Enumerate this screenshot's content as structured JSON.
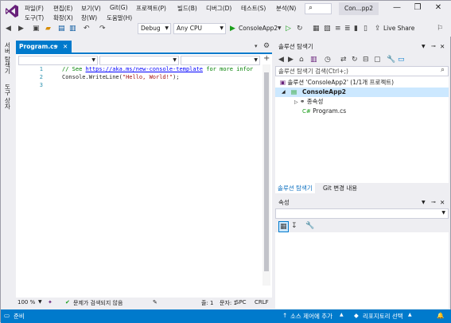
{
  "menu": {
    "items_row1": [
      "파일(F)",
      "편집(E)",
      "보기(V)",
      "Git(G)",
      "프로젝트(P)",
      "빌드(B)",
      "디버그(D)",
      "테스트(S)",
      "분석(N)"
    ],
    "items_row2": [
      "도구(T)",
      "확장(X)",
      "창(W)",
      "도움말(H)"
    ],
    "search_icon": "search-icon",
    "solution_name": "Con...pp2",
    "window_controls": [
      "—",
      "❐",
      "✕"
    ]
  },
  "toolbar": {
    "config": "Debug",
    "platform": "Any CPU",
    "start_target": "ConsoleApp2",
    "live_share": "Live Share"
  },
  "side_tabs": [
    "서버 탐색기",
    "도구 상자"
  ],
  "editor": {
    "tab_label": "Program.cs",
    "lines": [
      {
        "num": "1",
        "comment": "// See ",
        "link": "https://aka.ms/new-console-template",
        "rest": " for more infor"
      },
      {
        "num": "2",
        "code_pre": "Console.WriteLine(",
        "string": "\"Hello, World!\"",
        "code_post": ");"
      },
      {
        "num": "3"
      }
    ],
    "zoom": "100 %",
    "issues": "문제가 검색되지 않음",
    "line": "줄: 1",
    "col": "문자: 1",
    "spc": "SPC",
    "crlf": "CRLF"
  },
  "solution_explorer": {
    "title": "솔루션 탐색기",
    "search_placeholder": "솔루션 탐색기 검색(Ctrl+;)",
    "solution_label": "솔루션 'ConsoleApp2' (1/1개 프로젝트)",
    "project_label": "ConsoleApp2",
    "deps_label": "종속성",
    "file_label": "Program.cs",
    "tab_solution": "솔루션 탐색기",
    "tab_git": "Git 변경 내용"
  },
  "properties": {
    "title": "속성"
  },
  "statusbar": {
    "ready": "준비",
    "source_control": "소스 제어에 추가",
    "repo": "리포지토리 선택"
  },
  "colors": {
    "accent": "#007acc",
    "vs_purple": "#68217a",
    "comment": "#008000",
    "string": "#a31515",
    "line_number": "#2b91af"
  }
}
